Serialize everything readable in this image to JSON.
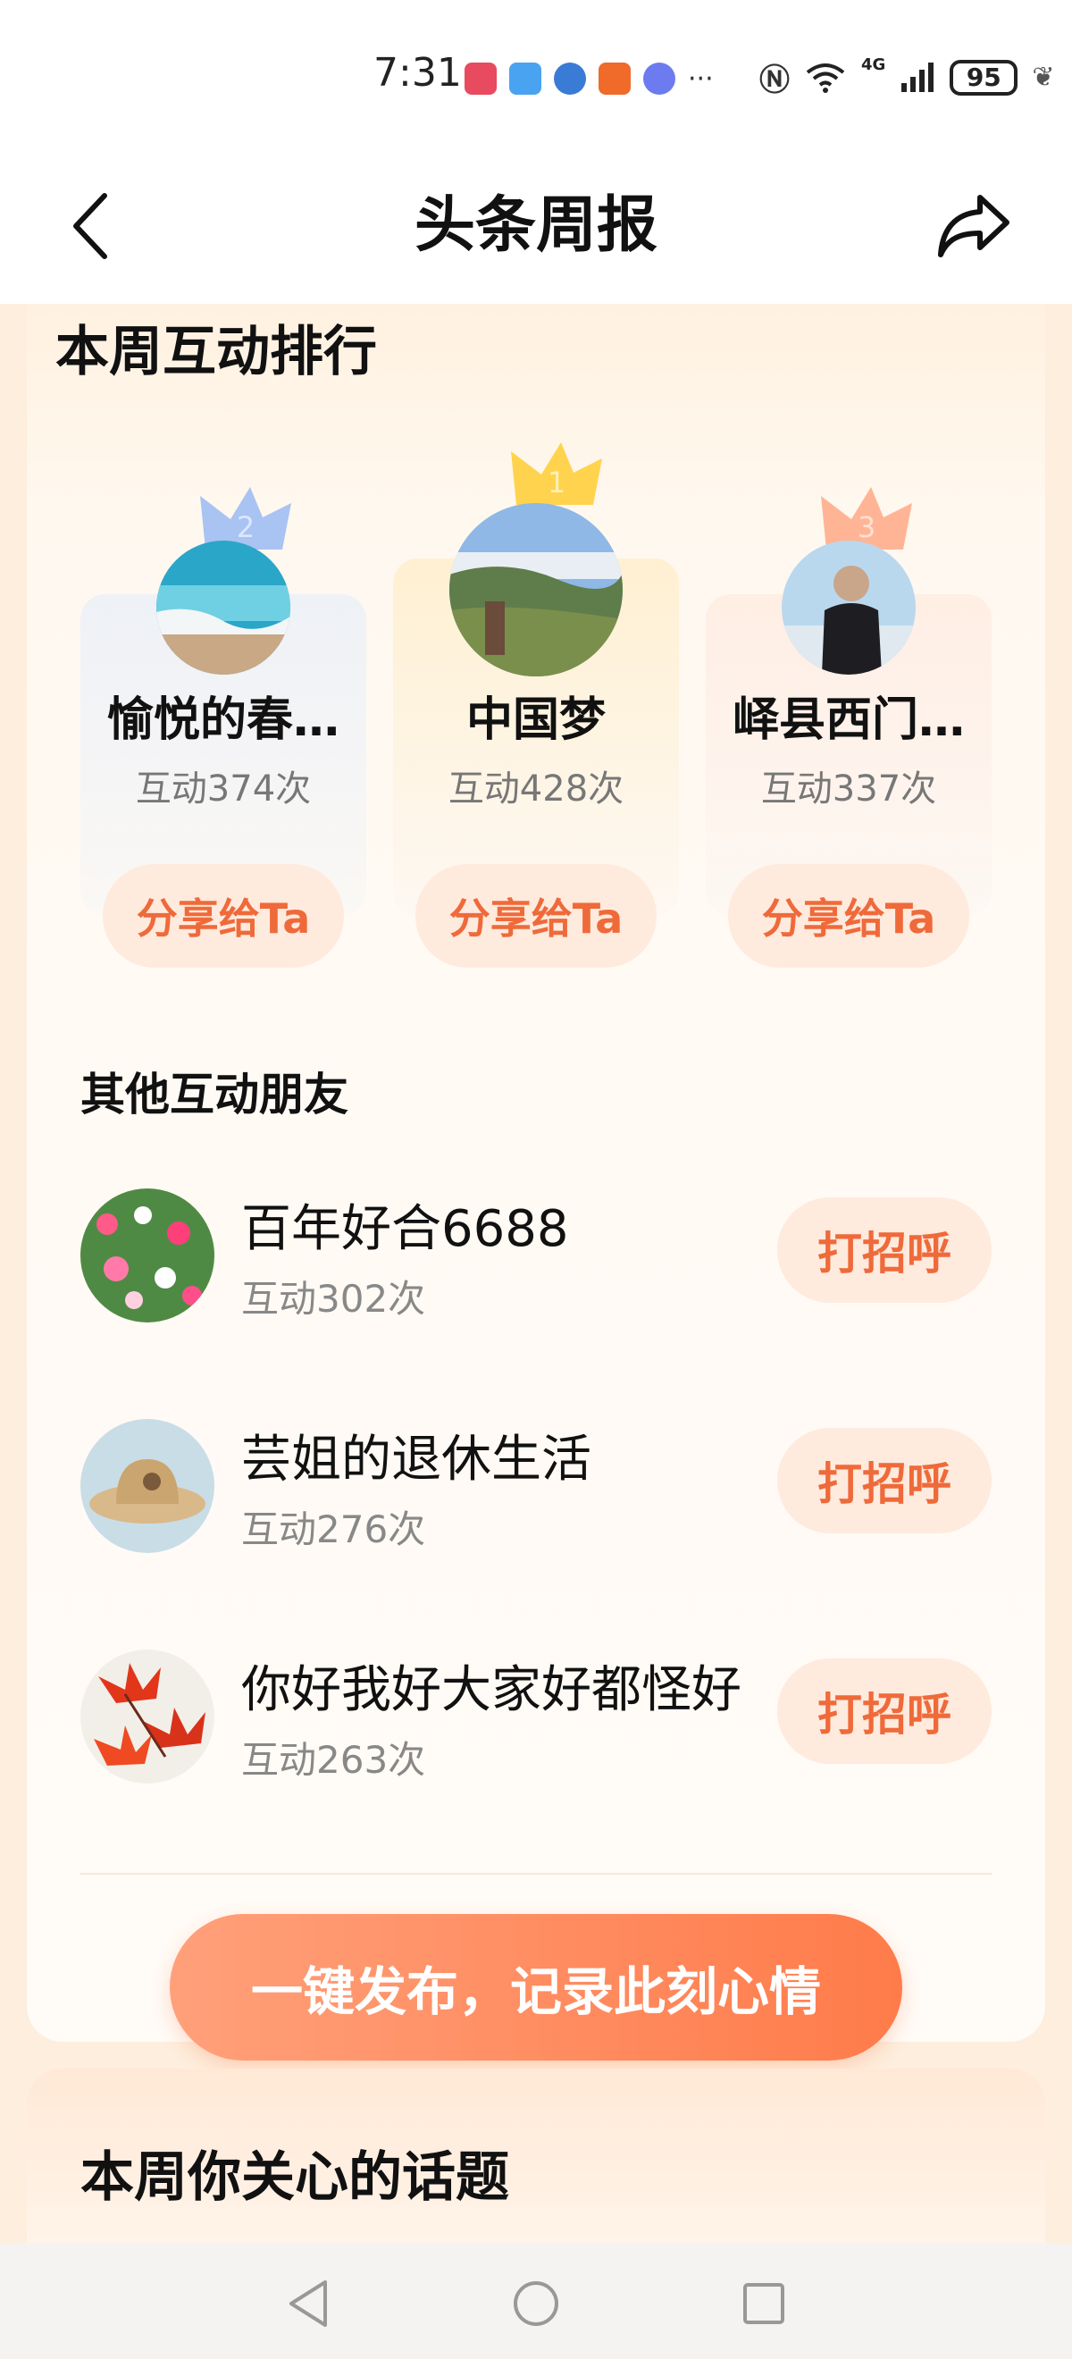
{
  "status_bar": {
    "time": "7:31",
    "battery": "95",
    "network": "4G"
  },
  "header": {
    "title": "头条周报"
  },
  "weekly_ranking": {
    "title": "本周互动排行",
    "podium": [
      {
        "rank": "2",
        "name": "愉悦的春…",
        "count": "互动374次",
        "share_label": "分享给Ta"
      },
      {
        "rank": "1",
        "name": "中国梦",
        "count": "互动428次",
        "share_label": "分享给Ta"
      },
      {
        "rank": "3",
        "name": "峄县西门…",
        "count": "互动337次",
        "share_label": "分享给Ta"
      }
    ]
  },
  "other_friends": {
    "title": "其他互动朋友",
    "items": [
      {
        "name": "百年好合6688",
        "count": "互动302次",
        "action": "打招呼"
      },
      {
        "name": "芸姐的退休生活",
        "count": "互动276次",
        "action": "打招呼"
      },
      {
        "name": "你好我好大家好都怪好",
        "count": "互动263次",
        "action": "打招呼"
      }
    ]
  },
  "publish_button": "一键发布，记录此刻心情",
  "topics_section": {
    "title": "本周你关心的话题"
  },
  "colors": {
    "accent": "#ef6a3a",
    "button_bg": "#ffeade",
    "card_bg": "#fffaf4"
  }
}
